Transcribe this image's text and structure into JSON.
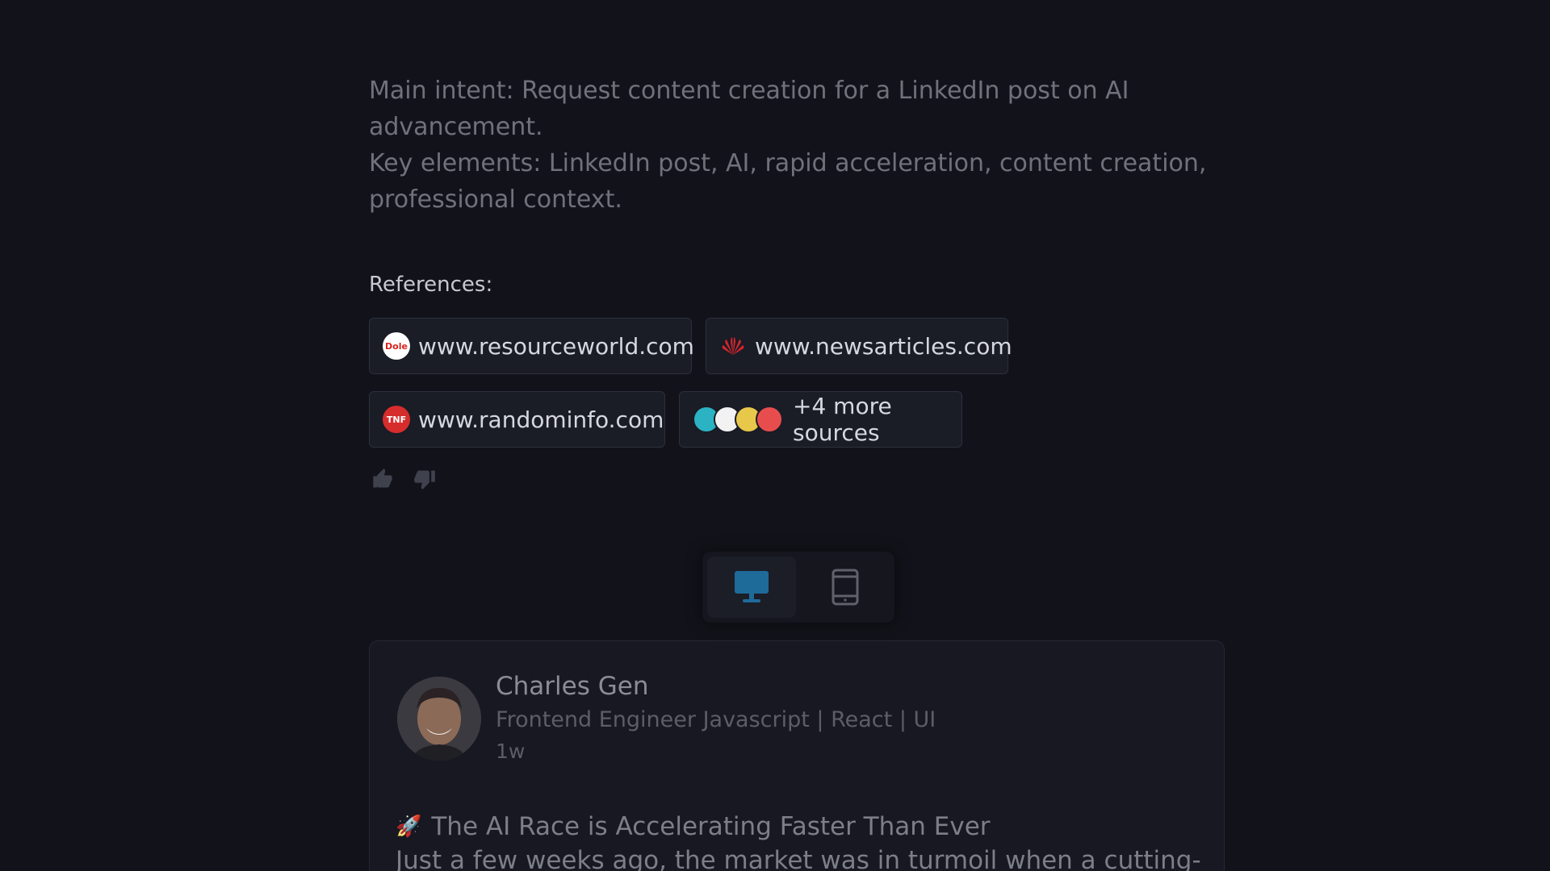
{
  "intent": {
    "main": "Main intent: Request content creation for a LinkedIn post on AI advancement.",
    "key": "Key elements: LinkedIn post, AI, rapid acceleration, content creation, professional context."
  },
  "references": {
    "label": "References:",
    "items": [
      {
        "url": "www.resourceworld.com",
        "icon": "dole-logo-icon"
      },
      {
        "url": "www.newsarticles.com",
        "icon": "huawei-logo-icon"
      },
      {
        "url": "www.randominfo.com",
        "icon": "north-face-logo-icon"
      }
    ],
    "more": "+4 more sources"
  },
  "feedback": {
    "like_icon": "thumbs-up-icon",
    "dislike_icon": "thumbs-down-icon"
  },
  "view_toggle": {
    "options": [
      "desktop",
      "mobile"
    ],
    "selected": "desktop",
    "accent": "#1e6b9a"
  },
  "post": {
    "author": "Charles Gen",
    "title": "Frontend Engineer Javascript | React | UI",
    "time": "1w",
    "headline_emoji": "🚀",
    "headline": "The AI Race is Accelerating Faster Than Ever",
    "body": "Just a few weeks ago, the market was in turmoil when a cutting-"
  }
}
